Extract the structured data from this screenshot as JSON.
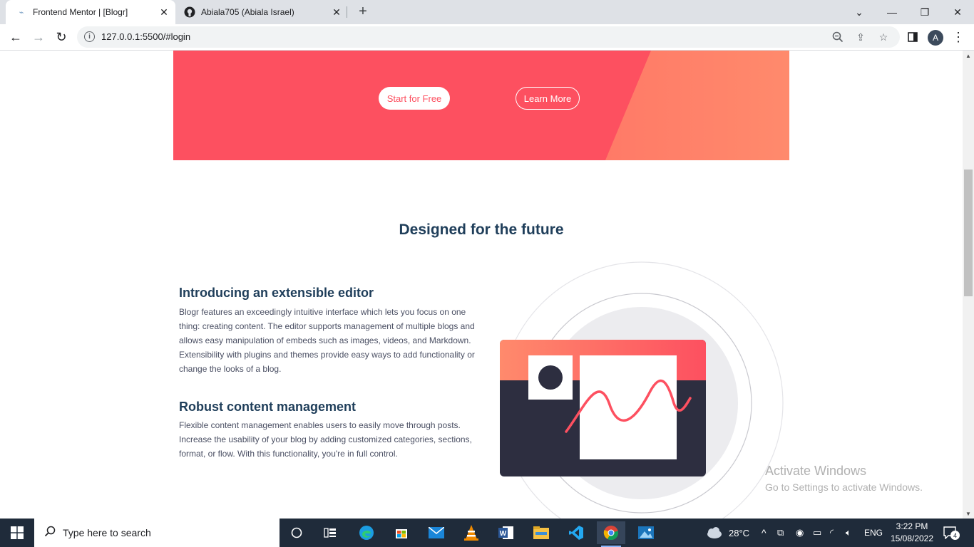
{
  "browser": {
    "tabs": [
      {
        "title": "Frontend Mentor | [Blogr]",
        "active": true
      },
      {
        "title": "Abiala705 (Abiala Israel)",
        "active": false
      }
    ],
    "url": "127.0.0.1:5500/#login",
    "profile_initial": "A"
  },
  "hero": {
    "start_label": "Start for Free",
    "learn_label": "Learn More"
  },
  "section": {
    "title": "Designed for the future",
    "features": [
      {
        "heading": "Introducing an extensible editor",
        "body": "Blogr features an exceedingly intuitive interface which lets you focus on one thing: creating content. The editor supports management of multiple blogs and allows easy manipulation of embeds such as images, videos, and Markdown. Extensibility with plugins and themes provide easy ways to add functionality or change the looks of a blog."
      },
      {
        "heading": "Robust content management",
        "body": "Flexible content management enables users to easily move through posts. Increase the usability of your blog by adding customized categories, sections, format, or flow. With this functionality, you're in full control."
      }
    ]
  },
  "watermark": {
    "line1": "Activate Windows",
    "line2": "Go to Settings to activate Windows."
  },
  "taskbar": {
    "search_placeholder": "Type here to search",
    "weather": "28°C",
    "language": "ENG",
    "time": "3:22 PM",
    "date": "15/08/2022",
    "notifications": "4"
  },
  "colors": {
    "hero_red": "#fd5060",
    "hero_coral": "#ff8368",
    "heading_navy": "#1f3e5a",
    "illustration_dark": "#2d2e40"
  }
}
